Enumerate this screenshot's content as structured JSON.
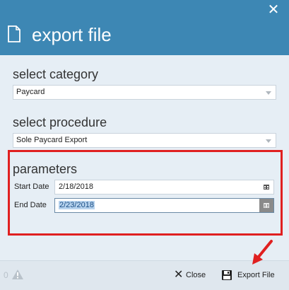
{
  "dialog": {
    "title": "export file",
    "close_icon": "close-icon",
    "title_icon": "file-icon"
  },
  "category": {
    "label": "select category",
    "value": "Paycard"
  },
  "procedure": {
    "label": "select procedure",
    "value": "Sole Paycard Export"
  },
  "parameters": {
    "heading": "parameters",
    "start_date": {
      "label": "Start Date",
      "value": "2/18/2018"
    },
    "end_date": {
      "label": "End Date",
      "value": "2/23/2018"
    }
  },
  "footer": {
    "warning_count": "0",
    "warning_icon": "warning-icon",
    "close_label": "Close",
    "export_label": "Export File"
  },
  "colors": {
    "header": "#3d87b4",
    "body": "#e6eef5",
    "highlight": "#e02020"
  }
}
